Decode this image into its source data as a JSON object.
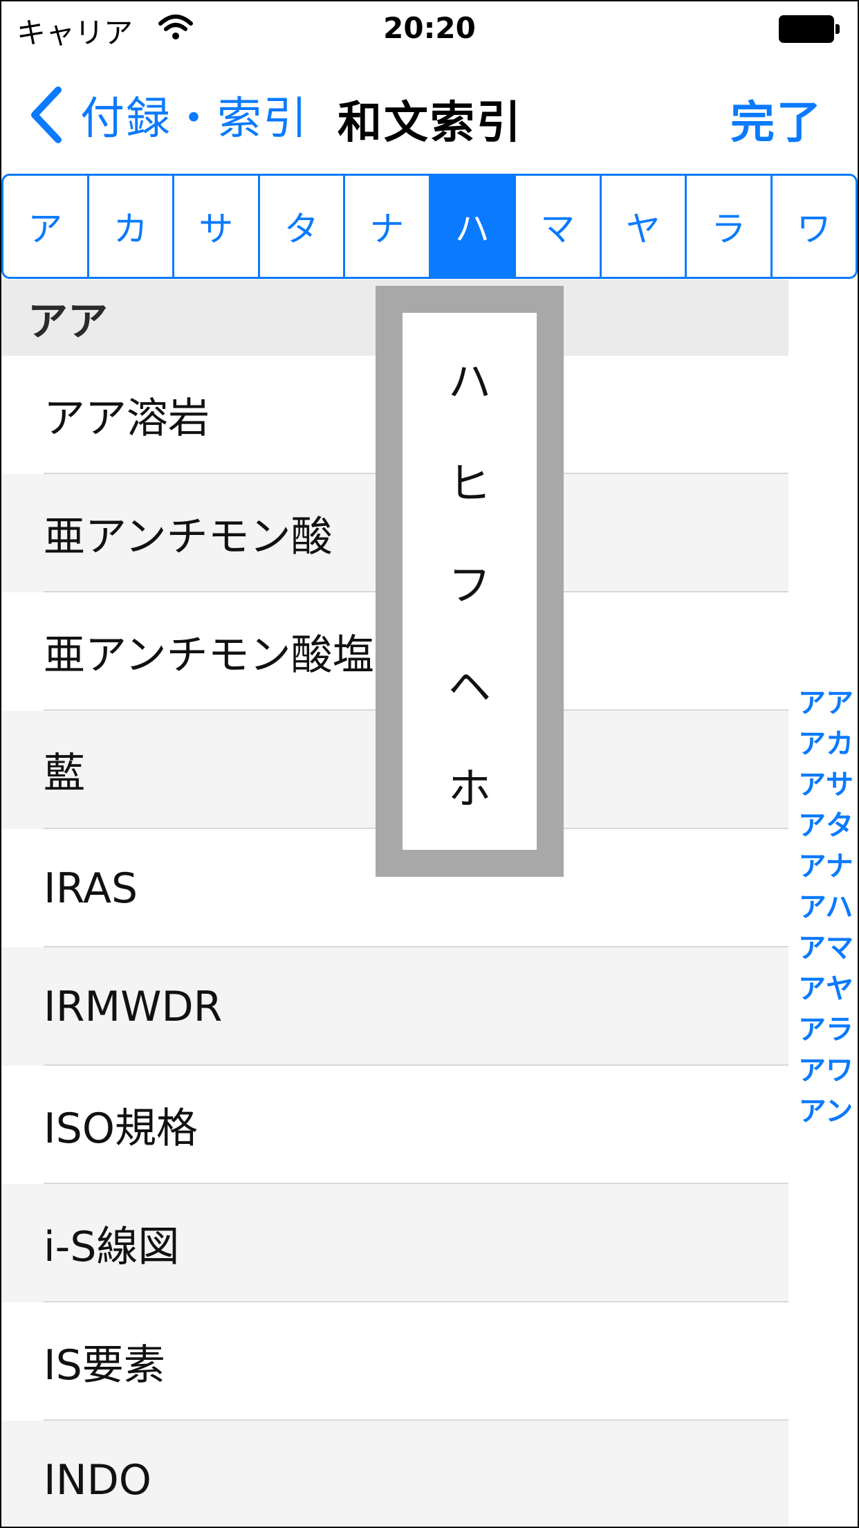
{
  "status_bar": {
    "carrier": "キャリア",
    "time": "20:20"
  },
  "nav": {
    "back_label": "付録・索引",
    "title": "和文索引",
    "done_label": "完了"
  },
  "segments": [
    "ア",
    "カ",
    "サ",
    "タ",
    "ナ",
    "ハ",
    "マ",
    "ヤ",
    "ラ",
    "ワ"
  ],
  "selected_segment": "ハ",
  "section": {
    "header": "アア",
    "rows": [
      "アア溶岩",
      "亜アンチモン酸",
      "亜アンチモン酸塩",
      "藍",
      "IRAS",
      "IRMWDR",
      "ISO規格",
      "i-S線図",
      "IS要素",
      "INDO"
    ]
  },
  "section_index": [
    "アア",
    "アカ",
    "アサ",
    "アタ",
    "アナ",
    "アハ",
    "アマ",
    "アヤ",
    "アラ",
    "アワ",
    "アン"
  ],
  "popup": {
    "items": [
      "ハ",
      "ヒ",
      "フ",
      "ヘ",
      "ホ"
    ]
  },
  "colors": {
    "accent": "#0a7afe",
    "section_header_bg": "#ebebeb",
    "popup_border": "#a8a8a8"
  }
}
